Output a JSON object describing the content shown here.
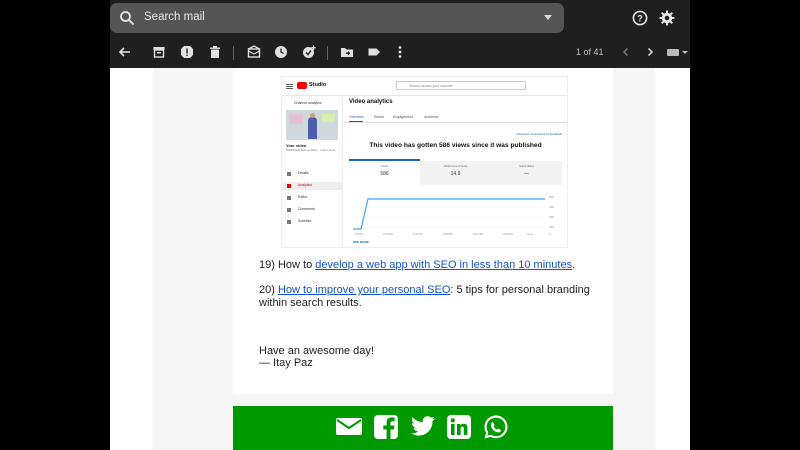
{
  "search": {
    "placeholder": "Search mail"
  },
  "pager": {
    "text": "1 of 41"
  },
  "icons": {
    "search": "search-icon",
    "help": "help-icon",
    "settings": "gear-icon",
    "back": "arrow-back-icon",
    "archive": "archive-icon",
    "spam": "report-spam-icon",
    "delete": "trash-icon",
    "unread": "mark-unread-icon",
    "snooze": "clock-icon",
    "task": "add-task-icon",
    "move": "folder-move-icon",
    "label": "label-icon",
    "more": "more-vert-icon",
    "prev": "chevron-left-icon",
    "next": "chevron-right-icon",
    "keyboard": "keyboard-icon"
  },
  "email": {
    "item19": {
      "prefix": "19) How to ",
      "link": "develop a web app with SEO in less than 10 minutes",
      "suffix": "."
    },
    "item20": {
      "prefix": "20) ",
      "link": "How to improve your personal SEO",
      "suffix": ": 5 tips for personal branding within search results."
    },
    "sign_off": "Have an awesome day!",
    "signature": "— Itay Paz"
  },
  "embedded_screenshot": {
    "app": "Studio",
    "search_placeholder": "Search across your channel",
    "back_label": "Channel analytics",
    "your_video": "Your video",
    "video_sub": "WEBINAR Boring 2020 – Learn How...",
    "nav": [
      "Details",
      "Analytics",
      "Editor",
      "Comments",
      "Subtitles"
    ],
    "title": "Video analytics",
    "tabs": [
      "Overview",
      "Reach",
      "Engagement",
      "Audience"
    ],
    "advanced": "Advanced mode",
    "feedback": "Send us feedback",
    "headline": "This video has gotten 586 views since it was published",
    "metrics": [
      {
        "label": "Views",
        "value": "586"
      },
      {
        "label": "Watch time (hours)",
        "value": "14.9"
      },
      {
        "label": "Subscribers",
        "value": "—"
      }
    ],
    "see_more": "SEE MORE",
    "colors": {
      "line": "#42a5f5",
      "accent": "#1565c0",
      "youtube_red": "#ff0000"
    }
  },
  "social": {
    "background": "#009900",
    "icons": [
      "envelope-icon",
      "facebook-icon",
      "twitter-icon",
      "linkedin-icon",
      "whatsapp-icon"
    ]
  }
}
